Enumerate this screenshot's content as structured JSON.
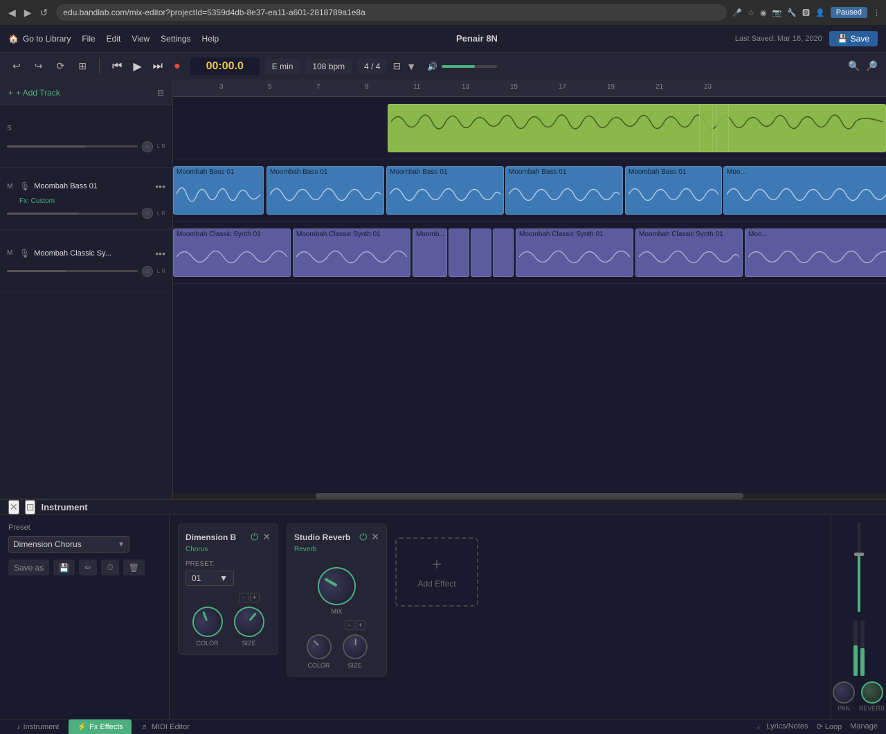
{
  "browser": {
    "url": "edu.bandlab.com/mix-editor?projectId=5359d4db-8e37-ea11-a601-2818789a1e8a",
    "back": "◀",
    "forward": "▶",
    "refresh": "↺",
    "paused_label": "Paused"
  },
  "header": {
    "go_to_library": "Go to Library",
    "menu": [
      "File",
      "Edit",
      "View",
      "Settings",
      "Help"
    ],
    "project_title": "Penair 8N",
    "last_saved": "Last Saved: Mar 16, 2020",
    "save_label": "Save"
  },
  "toolbar": {
    "undo": "↩",
    "redo": "↪",
    "loop": "⟳",
    "columns": "⊞",
    "skip_back": "⏮",
    "play": "▶",
    "skip_fwd": "⏭",
    "record": "●",
    "time": "00:00.0",
    "key": "E min",
    "bpm": "108 bpm",
    "time_sig": "4 / 4",
    "metronome": "♩",
    "volume_icon": "🔊",
    "zoom_in": "🔍+",
    "zoom_out": "🔍-"
  },
  "tracks": {
    "add_track": "+ Add Track",
    "items": [
      {
        "mode": "S",
        "name": "",
        "fx": "",
        "has_mic": false,
        "slider_pct": 60,
        "clip_color": "yellow",
        "clips": [
          {
            "label": "",
            "left_pct": 25,
            "width_pct": 75
          }
        ]
      },
      {
        "mode": "M",
        "name": "Moombah Bass 01",
        "fx": "Fx: Custom",
        "has_mic": true,
        "slider_pct": 55,
        "clip_color": "blue",
        "clips": [
          {
            "label": "Moombah Bass 01",
            "left_pct": 7,
            "width_pct": 14
          },
          {
            "label": "Moombah Bass 01",
            "left_pct": 22,
            "width_pct": 14
          },
          {
            "label": "Moombah Bass 01",
            "left_pct": 37,
            "width_pct": 14
          },
          {
            "label": "Moombah Bass 01",
            "left_pct": 52,
            "width_pct": 14
          },
          {
            "label": "Moo...",
            "left_pct": 67,
            "width_pct": 14
          },
          {
            "label": "Moo...",
            "left_pct": 81,
            "width_pct": 19
          }
        ]
      },
      {
        "mode": "M",
        "name": "Moombah Classic Sy...",
        "fx": "",
        "has_mic": true,
        "slider_pct": 45,
        "clip_color": "purple",
        "clips": [
          {
            "label": "Moombah Classic Synth 01",
            "left_pct": 7,
            "width_pct": 14
          },
          {
            "label": "Moombah Classic Synth 01",
            "left_pct": 22,
            "width_pct": 14
          },
          {
            "label": "Moomb...",
            "left_pct": 37,
            "width_pct": 4
          },
          {
            "label": "",
            "left_pct": 41,
            "width_pct": 3
          },
          {
            "label": "",
            "left_pct": 44,
            "width_pct": 3
          },
          {
            "label": "Moombah Classic Synth 01",
            "left_pct": 52,
            "width_pct": 14
          },
          {
            "label": "Moombah Classic Synth 01",
            "left_pct": 67,
            "width_pct": 14
          },
          {
            "label": "Moo...",
            "left_pct": 81,
            "width_pct": 19
          }
        ]
      }
    ]
  },
  "ruler": {
    "marks": [
      {
        "pos": 67,
        "label": "3"
      },
      {
        "pos": 137,
        "label": "5"
      },
      {
        "pos": 207,
        "label": "7"
      },
      {
        "pos": 277,
        "label": "9"
      },
      {
        "pos": 347,
        "label": "11"
      },
      {
        "pos": 417,
        "label": "13"
      },
      {
        "pos": 487,
        "label": "15"
      },
      {
        "pos": 557,
        "label": "17"
      },
      {
        "pos": 627,
        "label": "19"
      },
      {
        "pos": 697,
        "label": "21"
      },
      {
        "pos": 767,
        "label": "23"
      }
    ]
  },
  "bottom_panel": {
    "close_icon": "✕",
    "expand_icon": "⊡",
    "title": "Instrument",
    "preset": {
      "label": "Preset",
      "value": "Dimension Chorus",
      "arrow": "▼"
    },
    "actions": {
      "save_as": "Save as",
      "save_icon": "💾",
      "edit_icon": "✏",
      "history_icon": "⏱",
      "delete_icon": "🗑"
    },
    "effects": [
      {
        "id": "dimension-b",
        "title": "Dimension B",
        "subtitle": "Chorus",
        "on_icon": "⏻",
        "close_icon": "✕",
        "controls": [
          {
            "type": "preset_select",
            "label": "PRESET:",
            "value": "01",
            "arrow": "▼"
          }
        ],
        "knobs": [
          {
            "id": "color",
            "label": "COLOR"
          },
          {
            "id": "size",
            "label": "SIZE",
            "has_plus_minus": true
          }
        ]
      },
      {
        "id": "studio-reverb",
        "title": "Studio Reverb",
        "subtitle": "Reverb",
        "on_icon": "⏻",
        "close_icon": "✕",
        "controls": [],
        "knobs": [
          {
            "id": "mix",
            "label": "MIX"
          },
          {
            "id": "color2",
            "label": "COLOR"
          },
          {
            "id": "size2",
            "label": "SIZE"
          }
        ]
      }
    ],
    "add_effect_label": "Add Effect",
    "add_effect_plus": "+"
  },
  "bottom_tabs": [
    {
      "id": "instrument",
      "label": "Instrument",
      "icon": "♪",
      "active": false
    },
    {
      "id": "fx-effects",
      "label": "Fx Effects",
      "icon": "⚡",
      "active": true
    },
    {
      "id": "midi-editor",
      "label": "MIDI Editor",
      "icon": "♬",
      "active": false
    }
  ],
  "master": {
    "pan_label": "PAN",
    "reverb_label": "REVERB"
  }
}
